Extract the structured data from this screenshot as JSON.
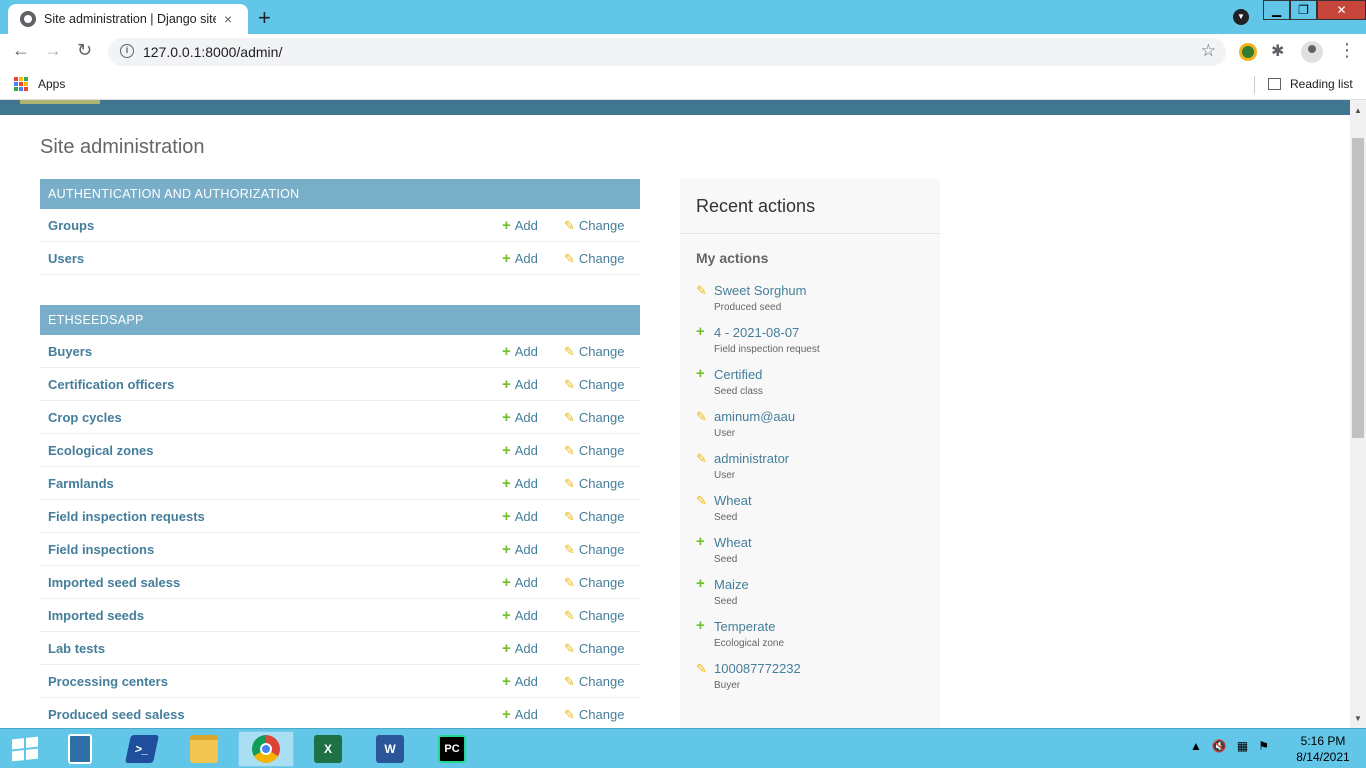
{
  "browser": {
    "tab_title": "Site administration | Django site admin",
    "tab_close": "×",
    "new_tab": "+",
    "url": "127.0.0.1:8000/admin/",
    "bookmarks": {
      "apps_label": "Apps",
      "reading_list_label": "Reading list"
    }
  },
  "page": {
    "title": "Site administration",
    "modules": [
      {
        "caption": "AUTHENTICATION AND AUTHORIZATION",
        "rows": [
          {
            "name": "Groups",
            "add": "Add",
            "change": "Change"
          },
          {
            "name": "Users",
            "add": "Add",
            "change": "Change"
          }
        ]
      },
      {
        "caption": "ETHSEEDSAPP",
        "rows": [
          {
            "name": "Buyers",
            "add": "Add",
            "change": "Change"
          },
          {
            "name": "Certification officers",
            "add": "Add",
            "change": "Change"
          },
          {
            "name": "Crop cycles",
            "add": "Add",
            "change": "Change"
          },
          {
            "name": "Ecological zones",
            "add": "Add",
            "change": "Change"
          },
          {
            "name": "Farmlands",
            "add": "Add",
            "change": "Change"
          },
          {
            "name": "Field inspection requests",
            "add": "Add",
            "change": "Change"
          },
          {
            "name": "Field inspections",
            "add": "Add",
            "change": "Change"
          },
          {
            "name": "Imported seed saless",
            "add": "Add",
            "change": "Change"
          },
          {
            "name": "Imported seeds",
            "add": "Add",
            "change": "Change"
          },
          {
            "name": "Lab tests",
            "add": "Add",
            "change": "Change"
          },
          {
            "name": "Processing centers",
            "add": "Add",
            "change": "Change"
          },
          {
            "name": "Produced seed saless",
            "add": "Add",
            "change": "Change"
          }
        ]
      }
    ],
    "recent_actions": {
      "heading": "Recent actions",
      "subheading": "My actions",
      "items": [
        {
          "icon": "pencil-icon",
          "object": "Sweet Sorghum",
          "type": "Produced seed"
        },
        {
          "icon": "plus-icon",
          "object": "4 - 2021-08-07",
          "type": "Field inspection request"
        },
        {
          "icon": "plus-icon",
          "object": "Certified",
          "type": "Seed class"
        },
        {
          "icon": "pencil-icon",
          "object": "aminum@aau",
          "type": "User"
        },
        {
          "icon": "pencil-icon",
          "object": "administrator",
          "type": "User"
        },
        {
          "icon": "pencil-icon",
          "object": "Wheat",
          "type": "Seed"
        },
        {
          "icon": "plus-icon",
          "object": "Wheat",
          "type": "Seed"
        },
        {
          "icon": "plus-icon",
          "object": "Maize",
          "type": "Seed"
        },
        {
          "icon": "plus-icon",
          "object": "Temperate",
          "type": "Ecological zone"
        },
        {
          "icon": "pencil-icon",
          "object": "100087772232",
          "type": "Buyer"
        }
      ]
    }
  },
  "taskbar": {
    "apps": [
      "explorer-window-icon",
      "powershell-icon",
      "file-explorer-icon",
      "chrome-icon",
      "excel-icon",
      "word-icon",
      "pycharm-icon"
    ],
    "excel_label": "X",
    "word_label": "W",
    "pycharm_label": "PC",
    "clock_time": "5:16 PM",
    "clock_date": "8/14/2021"
  },
  "colors": {
    "django_header": "#417690",
    "module_caption": "#79aec8",
    "link": "#447e9b",
    "add_icon": "#70bf2b",
    "change_icon": "#efb80b",
    "window_chrome": "#62c6e9"
  }
}
